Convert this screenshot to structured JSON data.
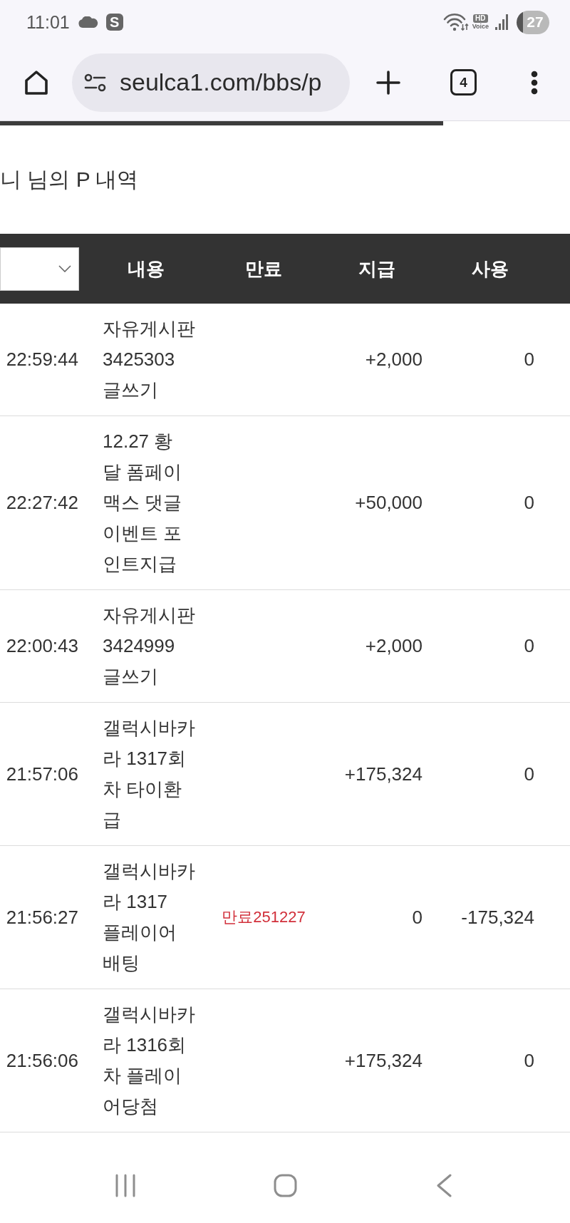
{
  "status_bar": {
    "time": "11:01",
    "app_letter": "S",
    "hd_label": "HD",
    "voice_label": "Voice",
    "battery": "27"
  },
  "toolbar": {
    "url": "seulca1.com/bbs/p",
    "tab_count": "4"
  },
  "page": {
    "title": "니 님의 P 내역"
  },
  "table": {
    "columns": [
      {
        "kind": "select"
      },
      {
        "kind": "label",
        "label": "내용"
      },
      {
        "kind": "label",
        "label": "만료"
      },
      {
        "kind": "label",
        "label": "지급"
      },
      {
        "kind": "label",
        "label": "사용"
      }
    ],
    "rows": [
      {
        "time": "22:59:44",
        "content": "자유게시판\n3425303\n글쓰기",
        "granted": "+2,000",
        "used": "0"
      },
      {
        "time": "22:27:42",
        "content": "12.27 황\n달 폼페이\n맥스 댓글\n이벤트 포\n인트지급",
        "granted": "+50,000",
        "used": "0"
      },
      {
        "time": "22:00:43",
        "content": "자유게시판\n3424999\n글쓰기",
        "granted": "+2,000",
        "used": "0"
      },
      {
        "time": "21:57:06",
        "content": "갤럭시바카\n라 1317회\n차 타이환\n급",
        "granted": "+175,324",
        "used": "0"
      },
      {
        "time": "21:56:27",
        "content": "갤럭시바카\n라 1317\n플레이어\n배팅",
        "expiry": "만료251227",
        "granted": "0",
        "used": "-175,324"
      },
      {
        "time": "21:56:06",
        "content": "갤럭시바카\n라 1316회\n차 플레이\n어당첨",
        "granted": "+175,324",
        "used": "0"
      }
    ]
  }
}
